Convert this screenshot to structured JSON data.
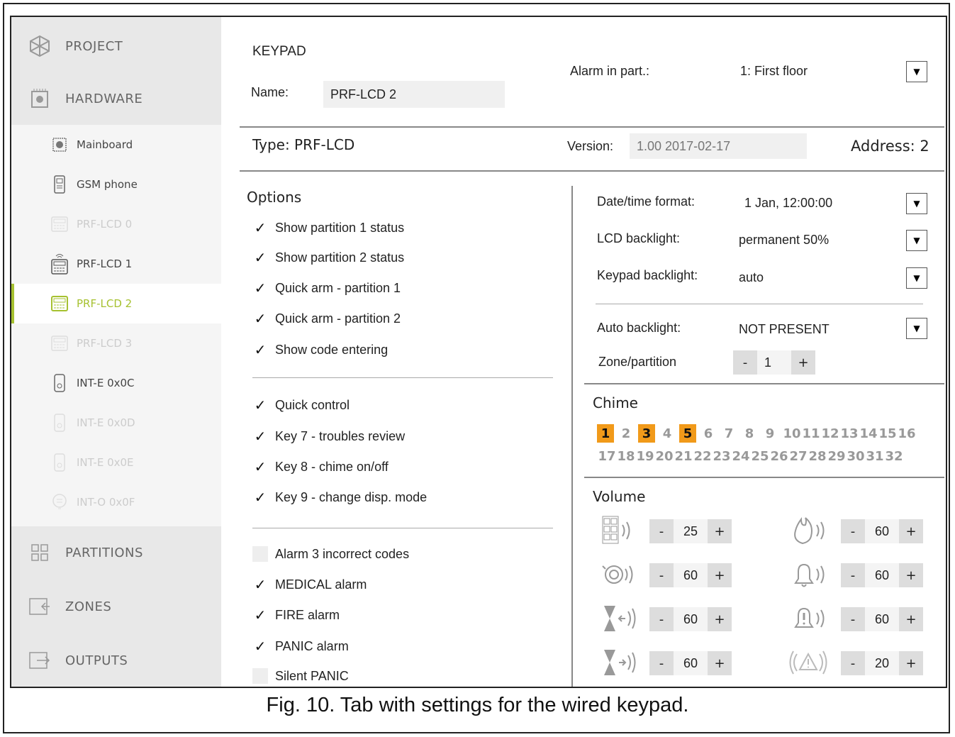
{
  "sidebar": {
    "main_top": [
      {
        "label": "PROJECT",
        "icon": "project-icon"
      },
      {
        "label": "HARDWARE",
        "icon": "hardware-icon"
      }
    ],
    "sub": [
      {
        "label": "Mainboard",
        "icon": "mainboard-icon",
        "state": "normal"
      },
      {
        "label": "GSM phone",
        "icon": "phone-icon",
        "state": "normal"
      },
      {
        "label": "PRF-LCD 0",
        "icon": "keypad-icon",
        "state": "dim"
      },
      {
        "label": "PRF-LCD 1",
        "icon": "keypad-wireless-icon",
        "state": "normal"
      },
      {
        "label": "PRF-LCD 2",
        "icon": "keypad-icon",
        "state": "active"
      },
      {
        "label": "PRF-LCD 3",
        "icon": "keypad-icon",
        "state": "dim"
      },
      {
        "label": "INT-E 0x0C",
        "icon": "expander-icon",
        "state": "normal"
      },
      {
        "label": "INT-E 0x0D",
        "icon": "expander-icon",
        "state": "dim"
      },
      {
        "label": "INT-E 0x0E",
        "icon": "expander-icon",
        "state": "dim"
      },
      {
        "label": "INT-O 0x0F",
        "icon": "output-module-icon",
        "state": "dim"
      }
    ],
    "main_bottom": [
      {
        "label": "PARTITIONS",
        "icon": "partitions-icon"
      },
      {
        "label": "ZONES",
        "icon": "zones-icon"
      },
      {
        "label": "OUTPUTS",
        "icon": "outputs-icon"
      }
    ]
  },
  "header": {
    "title": "KEYPAD",
    "name_label": "Name:",
    "name_value": "PRF-LCD 2",
    "alarm_label": "Alarm in part.:",
    "alarm_value": "1: First floor",
    "type_label": "Type:",
    "type_value": "PRF-LCD",
    "version_label": "Version:",
    "version_value": "1.00 2017-02-17",
    "address_label": "Address:",
    "address_value": "2"
  },
  "options": {
    "title": "Options",
    "group1": [
      {
        "label": "Show partition 1 status",
        "checked": true
      },
      {
        "label": "Show partition 2 status",
        "checked": true
      },
      {
        "label": "Quick arm - partition 1",
        "checked": true
      },
      {
        "label": "Quick arm - partition 2",
        "checked": true
      },
      {
        "label": "Show code entering",
        "checked": true
      }
    ],
    "group2": [
      {
        "label": "Quick control",
        "checked": true
      },
      {
        "label": "Key 7 - troubles review",
        "checked": true
      },
      {
        "label": "Key 8 - chime on/off",
        "checked": true
      },
      {
        "label": "Key 9 - change disp. mode",
        "checked": true
      }
    ],
    "group3": [
      {
        "label": "Alarm 3 incorrect codes",
        "checked": false
      },
      {
        "label": "MEDICAL alarm",
        "checked": true
      },
      {
        "label": "FIRE alarm",
        "checked": true
      },
      {
        "label": "PANIC alarm",
        "checked": true
      },
      {
        "label": "Silent PANIC",
        "checked": false
      }
    ]
  },
  "settings": {
    "datetime_label": "Date/time format:",
    "datetime_value": "1 Jan, 12:00:00",
    "lcd_label": "LCD backlight:",
    "lcd_value": "permanent 50%",
    "keypad_bl_label": "Keypad backlight:",
    "keypad_bl_value": "auto",
    "auto_bl_label": "Auto backlight:",
    "auto_bl_value": "NOT PRESENT",
    "zone_label": "Zone/partition",
    "zone_value": "1",
    "minus": "-",
    "plus": "+"
  },
  "chime": {
    "title": "Chime",
    "row1": [
      "1",
      "2",
      "3",
      "4",
      "5",
      "6",
      "7",
      "8",
      "9",
      "10",
      "11",
      "12",
      "13",
      "14",
      "15",
      "16"
    ],
    "row2": [
      "17",
      "18",
      "19",
      "20",
      "21",
      "22",
      "23",
      "24",
      "25",
      "26",
      "27",
      "28",
      "29",
      "30",
      "31",
      "32"
    ],
    "active": [
      "1",
      "3",
      "5"
    ]
  },
  "volume": {
    "title": "Volume",
    "left": [
      {
        "icon": "keys-volume-icon",
        "value": "25"
      },
      {
        "icon": "alarm-volume-icon",
        "value": "60"
      },
      {
        "icon": "entry-delay-volume-icon",
        "value": "60"
      },
      {
        "icon": "exit-delay-volume-icon",
        "value": "60"
      }
    ],
    "right": [
      {
        "icon": "fire-volume-icon",
        "value": "60"
      },
      {
        "icon": "bell-volume-icon",
        "value": "60"
      },
      {
        "icon": "bell-alert-volume-icon",
        "value": "60"
      },
      {
        "icon": "warning-volume-icon",
        "value": "20"
      }
    ]
  },
  "caption": "Fig. 10. Tab with settings for the wired keypad."
}
